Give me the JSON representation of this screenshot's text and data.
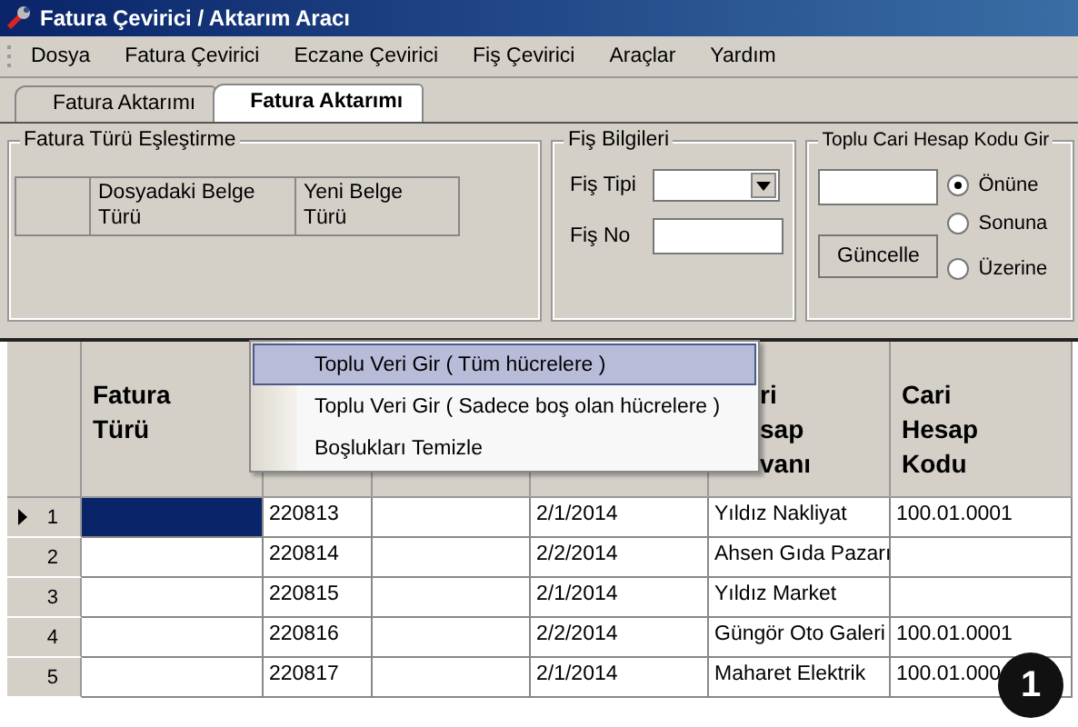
{
  "window": {
    "title": "Fatura Çevirici / Aktarım Aracı"
  },
  "menu": [
    "Dosya",
    "Fatura Çevirici",
    "Eczane Çevirici",
    "Fiş Çevirici",
    "Araçlar",
    "Yardım"
  ],
  "tabs": [
    {
      "label": "Fatura Aktarımı",
      "selected": false
    },
    {
      "label": "Fatura Aktarımı",
      "selected": true
    }
  ],
  "type_mapping": {
    "title": "Fatura Türü Eşleştirme",
    "columns": [
      "Dosyadaki Belge Türü",
      "Yeni Belge Türü"
    ]
  },
  "receipt": {
    "title": "Fiş Bilgileri",
    "type_label": "Fiş Tipi",
    "no_label": "Fiş No"
  },
  "bulk_code": {
    "title": "Toplu Cari Hesap Kodu Gir",
    "button": "Güncelle",
    "options": [
      {
        "label": "Önüne",
        "selected": true
      },
      {
        "label": "Sonuna",
        "selected": false
      },
      {
        "label": "Üzerine",
        "selected": false
      }
    ]
  },
  "table": {
    "columns": [
      {
        "header_lines": [
          "Fatura",
          "Türü"
        ]
      },
      {},
      {},
      {},
      {
        "header_lines": [
          "ri",
          "sap",
          "vanı"
        ]
      },
      {
        "header_lines": [
          "Cari",
          "Hesap",
          "Kodu"
        ]
      }
    ],
    "rows": [
      {
        "number": "1",
        "current": true,
        "first_cell_selected": true,
        "column_2": "220813",
        "column_4": "2/1/2014",
        "column_5": "Yıldız Nakliyat",
        "column_6": "100.01.0001"
      },
      {
        "number": "2",
        "current": false,
        "first_cell_selected": false,
        "column_2": "220814",
        "column_4": "2/2/2014",
        "column_5": "Ahsen Gıda Pazarı"
      },
      {
        "number": "3",
        "current": false,
        "first_cell_selected": false,
        "column_2": "220815",
        "column_4": "2/1/2014",
        "column_5": "Yıldız Market"
      },
      {
        "number": "4",
        "current": false,
        "first_cell_selected": false,
        "column_2": "220816",
        "column_4": "2/2/2014",
        "column_5": "Güngör Oto Galeri",
        "column_6": "100.01.0001"
      },
      {
        "number": "5",
        "current": false,
        "first_cell_selected": false,
        "column_2": "220817",
        "column_4": "2/1/2014",
        "column_5": "Maharet Elektrik",
        "column_6": "100.01.000"
      }
    ]
  },
  "context_menu": [
    {
      "label": "Toplu Veri Gir ( Tüm hücrelere )",
      "selected": true
    },
    {
      "label": "Toplu Veri Gir ( Sadece boş olan hücrelere )",
      "selected": false
    },
    {
      "label": "Boşlukları Temizle",
      "selected": false
    }
  ],
  "callout": "1"
}
